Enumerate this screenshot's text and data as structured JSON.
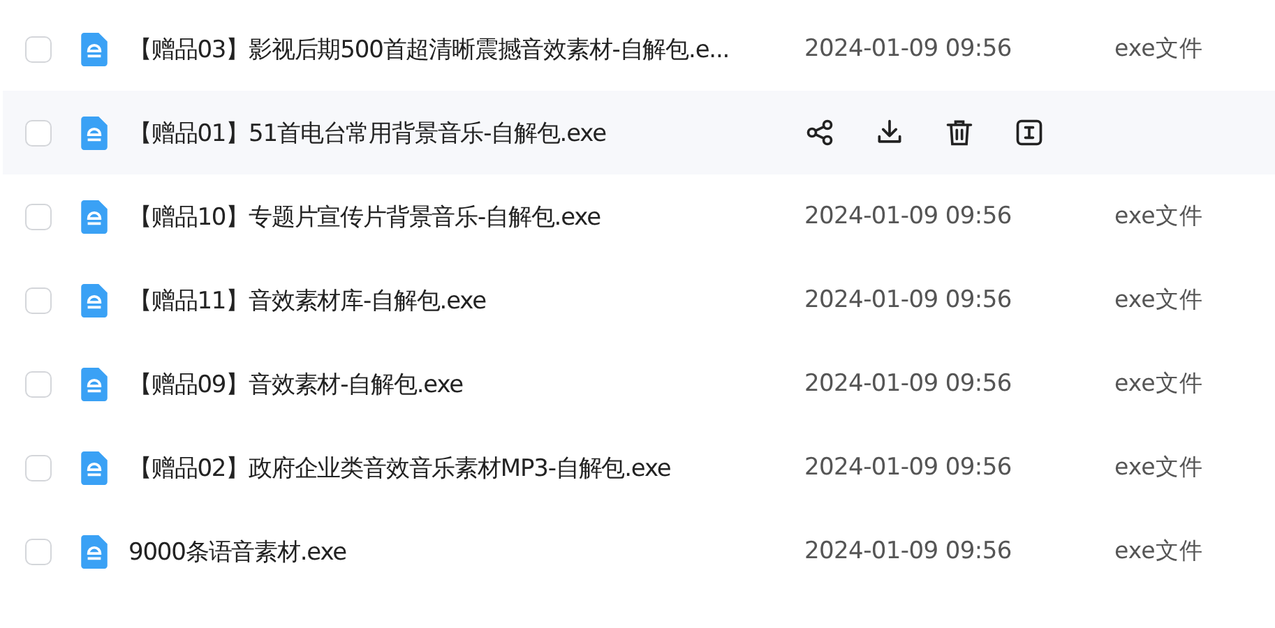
{
  "files": [
    {
      "name": "【赠品03】影视后期500首超清晰震撼音效素材-自解包.e...",
      "date": "2024-01-09 09:56",
      "type": "exe文件",
      "checked": false,
      "hovered": false
    },
    {
      "name": "【赠品01】51首电台常用背景音乐-自解包.exe",
      "checked": false,
      "hovered": true
    },
    {
      "name": "【赠品10】专题片宣传片背景音乐-自解包.exe",
      "date": "2024-01-09 09:56",
      "type": "exe文件",
      "checked": false,
      "hovered": false
    },
    {
      "name": "【赠品11】音效素材库-自解包.exe",
      "date": "2024-01-09 09:56",
      "type": "exe文件",
      "checked": false,
      "hovered": false
    },
    {
      "name": "【赠品09】音效素材-自解包.exe",
      "date": "2024-01-09 09:56",
      "type": "exe文件",
      "checked": false,
      "hovered": false
    },
    {
      "name": "【赠品02】政府企业类音效音乐素材MP3-自解包.exe",
      "date": "2024-01-09 09:56",
      "type": "exe文件",
      "checked": false,
      "hovered": false
    },
    {
      "name": "9000条语音素材.exe",
      "date": "2024-01-09 09:56",
      "type": "exe文件",
      "checked": false,
      "hovered": false
    }
  ]
}
